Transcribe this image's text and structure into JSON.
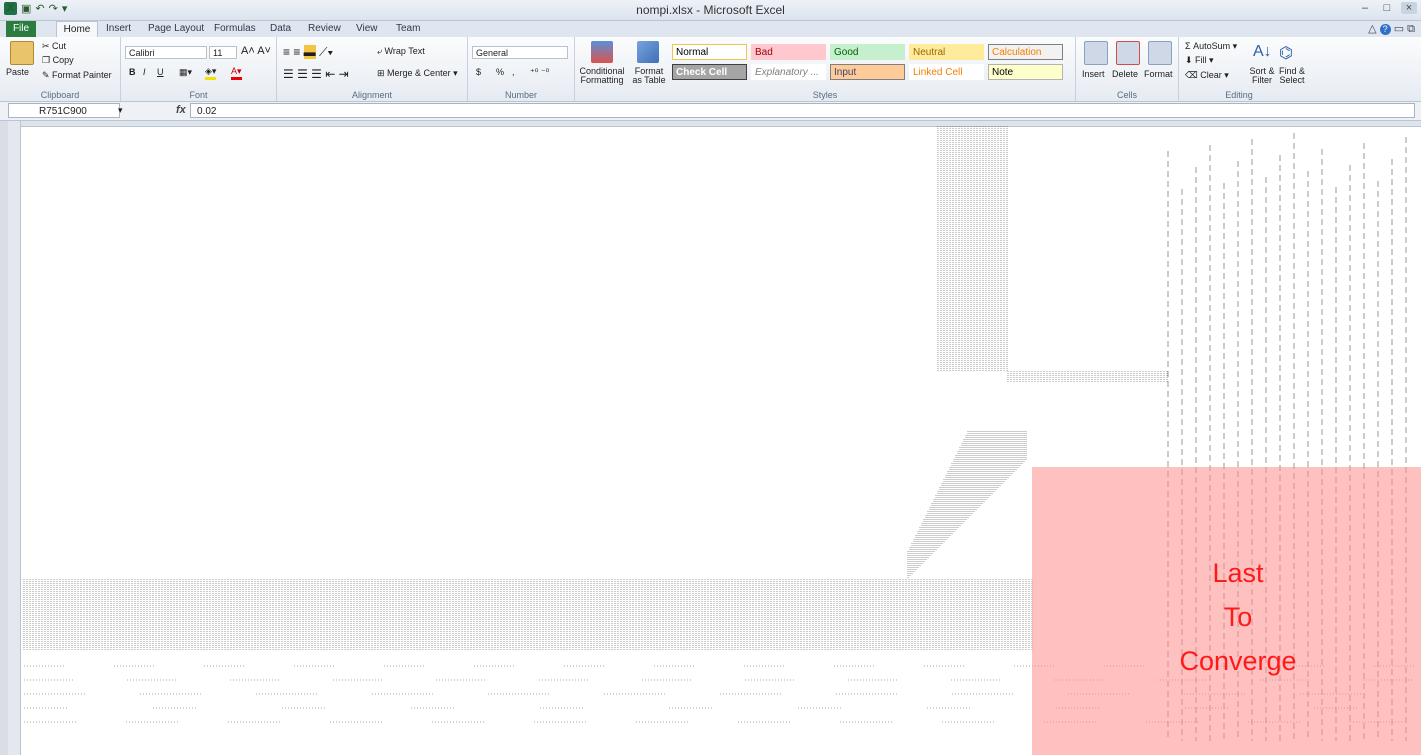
{
  "window": {
    "title": "nompi.xlsx - Microsoft Excel",
    "controls": [
      "–",
      "□",
      "×"
    ]
  },
  "tabs": [
    "File",
    "Home",
    "Insert",
    "Page Layout",
    "Formulas",
    "Data",
    "Review",
    "View",
    "Team"
  ],
  "ribbon": {
    "clipboard": {
      "label": "Clipboard",
      "paste": "Paste",
      "cut": "Cut",
      "copy": "Copy",
      "format_painter": "Format Painter"
    },
    "font": {
      "label": "Font",
      "name": "Calibri",
      "size": "11",
      "bold": "B",
      "italic": "I",
      "underline": "U"
    },
    "alignment": {
      "label": "Alignment",
      "wrap_text": "Wrap Text",
      "merge_center": "Merge & Center"
    },
    "number": {
      "label": "Number",
      "format": "General",
      "currency": "$",
      "percent": "%",
      "comma": ","
    },
    "styles": {
      "label": "Styles",
      "conditional": "Conditional Formatting",
      "format_table": "Format as Table",
      "cells": [
        {
          "name": "Normal",
          "bg": "#ffffff",
          "fg": "#000000",
          "border": "#f0c64a"
        },
        {
          "name": "Bad",
          "bg": "#ffc7ce",
          "fg": "#9c0006",
          "border": "#ffc7ce"
        },
        {
          "name": "Good",
          "bg": "#c6efce",
          "fg": "#006100",
          "border": "#c6efce"
        },
        {
          "name": "Neutral",
          "bg": "#ffeb9c",
          "fg": "#9c6500",
          "border": "#ffeb9c"
        },
        {
          "name": "Calculation",
          "bg": "#f2f2f2",
          "fg": "#fa7d00",
          "border": "#7f7f7f"
        },
        {
          "name": "Check Cell",
          "bg": "#a5a5a5",
          "fg": "#ffffff",
          "border": "#3f3f3f"
        },
        {
          "name": "Explanatory ...",
          "bg": "#ffffff",
          "fg": "#7f7f7f",
          "border": "#ffffff"
        },
        {
          "name": "Input",
          "bg": "#ffcc99",
          "fg": "#3f3f76",
          "border": "#7f7f7f"
        },
        {
          "name": "Linked Cell",
          "bg": "#ffffff",
          "fg": "#fa7d00",
          "border": "#ffffff"
        },
        {
          "name": "Note",
          "bg": "#ffffcc",
          "fg": "#000000",
          "border": "#b2b2b2"
        }
      ]
    },
    "cells": {
      "label": "Cells",
      "insert": "Insert",
      "delete": "Delete",
      "format": "Format"
    },
    "editing": {
      "label": "Editing",
      "autosum": "AutoSum",
      "fill": "Fill",
      "clear": "Clear",
      "sort_filter": "Sort & Filter",
      "find_select": "Find & Select"
    }
  },
  "formula_bar": {
    "name_box": "R751C900",
    "fx": "fx",
    "value": "0.02"
  },
  "overlay": {
    "lines": [
      "Last",
      "To",
      "Converge"
    ],
    "color": "#ff1a1a"
  }
}
